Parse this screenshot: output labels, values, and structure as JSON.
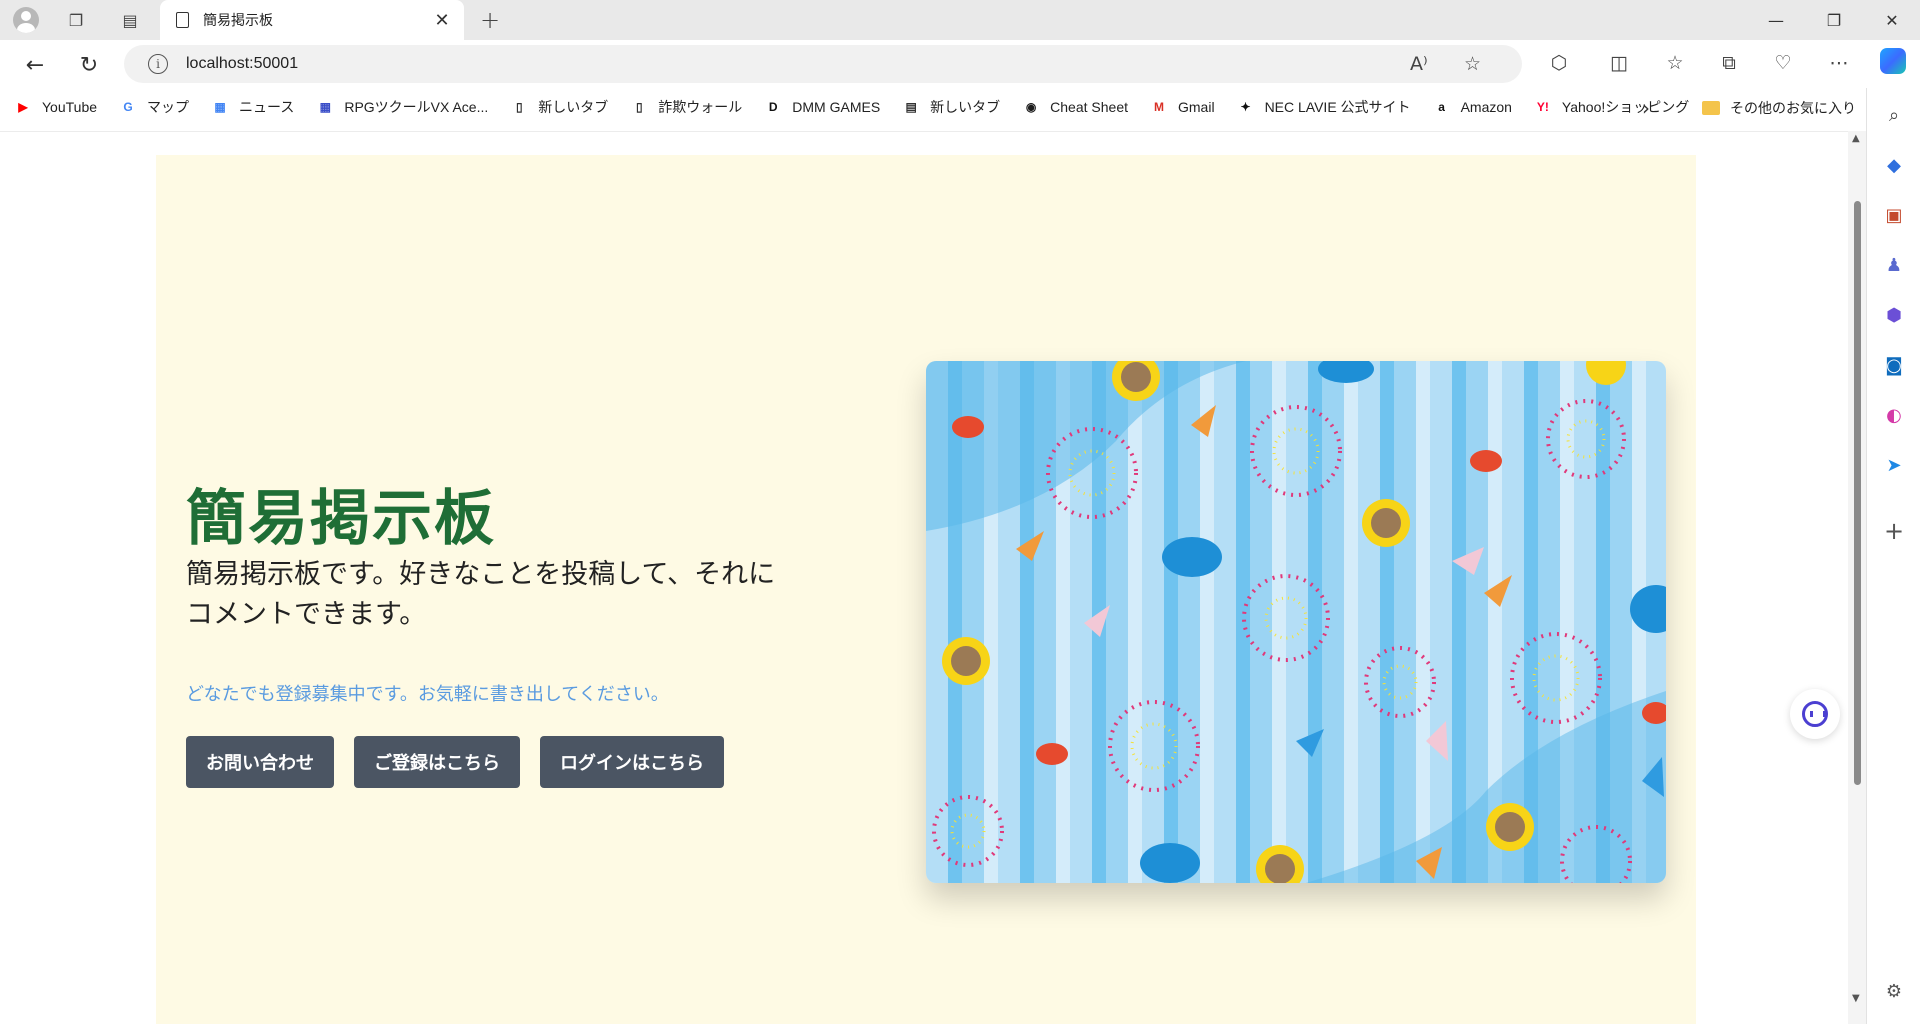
{
  "browser": {
    "tab_title": "簡易掲示板",
    "url": "localhost:50001",
    "bookmarks": [
      {
        "label": "YouTube",
        "icon": "youtube-icon",
        "color": "#ff0000"
      },
      {
        "label": "マップ",
        "icon": "google-icon",
        "color": "#4285f4"
      },
      {
        "label": "ニュース",
        "icon": "news-icon",
        "color": "#4285f4"
      },
      {
        "label": "RPGツクールVX Ace...",
        "icon": "grid-icon",
        "color": "#3a4ec8"
      },
      {
        "label": "新しいタブ",
        "icon": "page-icon",
        "color": "#333333"
      },
      {
        "label": "詐欺ウォール",
        "icon": "page-icon",
        "color": "#333333"
      },
      {
        "label": "DMM GAMES",
        "icon": "dmm-icon",
        "color": "#111111"
      },
      {
        "label": "新しいタブ",
        "icon": "calendar-icon",
        "color": "#333333"
      },
      {
        "label": "Cheat Sheet",
        "icon": "cheatsheet-icon",
        "color": "#1d1d1d"
      },
      {
        "label": "Gmail",
        "icon": "gmail-icon",
        "color": "#d93025"
      },
      {
        "label": "NEC LAVIE 公式サイト",
        "icon": "nec-icon",
        "color": "#111111"
      },
      {
        "label": "Amazon",
        "icon": "amazon-icon",
        "color": "#111111"
      },
      {
        "label": "Yahoo!ショッピング",
        "icon": "yahoo-icon",
        "color": "#ff0033"
      }
    ],
    "other_bookmarks": "その他のお気に入り"
  },
  "page": {
    "title": "簡易掲示板",
    "description": "簡易掲示板です。好きなことを投稿して、それにコメントできます。",
    "subtext": "どなたでも登録募集中です。お気軽に書き出してください。",
    "buttons": {
      "contact": "お問い合わせ",
      "register": "ご登録はこちら",
      "login": "ログインはこちら"
    }
  },
  "colors": {
    "hero_bg": "#fefae4",
    "title": "#1f6e36",
    "subtext": "#5a9be0",
    "button": "#4b5563"
  }
}
